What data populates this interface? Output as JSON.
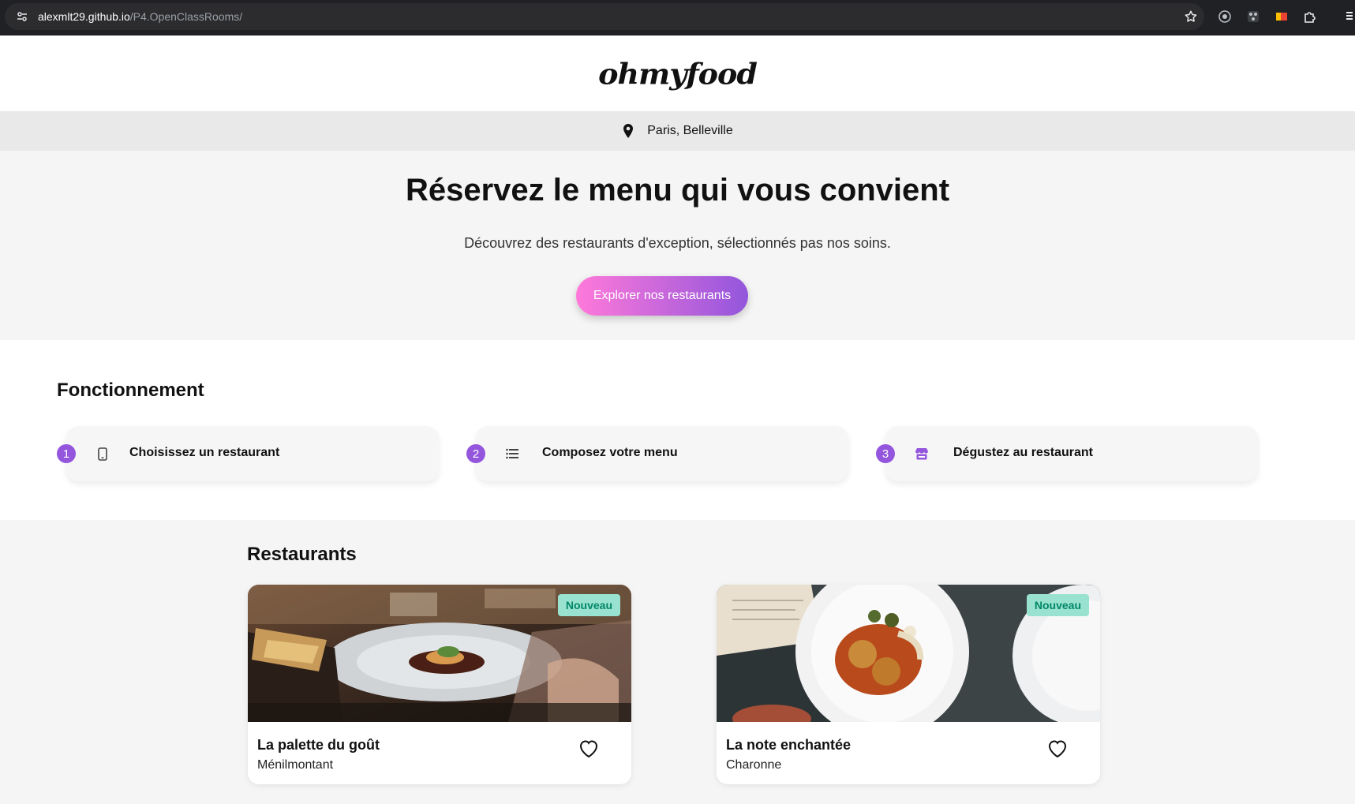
{
  "browser": {
    "url_host": "alexmlt29.github.io",
    "url_path": "/P4.OpenClassRooms/"
  },
  "header": {
    "logo": "ohmyfood",
    "location": "Paris, Belleville"
  },
  "hero": {
    "title": "Réservez le menu qui vous convient",
    "subtitle": "Découvrez des restaurants d'exception, sélectionnés pas nos soins.",
    "cta_label": "Explorer nos restaurants"
  },
  "how": {
    "title": "Fonctionnement",
    "steps": [
      {
        "number": "1",
        "icon": "mobile-phone-icon",
        "label": "Choisissez un restaurant"
      },
      {
        "number": "2",
        "icon": "list-icon",
        "label": "Composez votre menu"
      },
      {
        "number": "3",
        "icon": "store-icon",
        "label": "Dégustez au restaurant"
      }
    ]
  },
  "restaurants": {
    "title": "Restaurants",
    "items": [
      {
        "name": "La palette du goût",
        "area": "Ménilmontant",
        "badge": "Nouveau",
        "image": "plated-dish-photo"
      },
      {
        "name": "La note enchantée",
        "area": "Charonne",
        "badge": "Nouveau",
        "image": "tapas-plate-photo"
      }
    ]
  },
  "colors": {
    "accent_purple": "#9356dc",
    "accent_pink": "#ff79da",
    "badge_bg": "#99e2d0",
    "badge_text": "#008766"
  }
}
